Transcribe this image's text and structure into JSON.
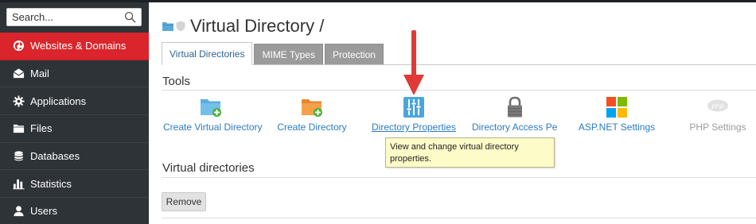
{
  "sidebar": {
    "search": {
      "placeholder": "Search..."
    },
    "items": [
      {
        "label": "Websites & Domains",
        "icon": "globe-icon",
        "active": true
      },
      {
        "label": "Mail",
        "icon": "mail-icon",
        "active": false
      },
      {
        "label": "Applications",
        "icon": "gear-icon",
        "active": false
      },
      {
        "label": "Files",
        "icon": "folder-icon",
        "active": false
      },
      {
        "label": "Databases",
        "icon": "database-icon",
        "active": false
      },
      {
        "label": "Statistics",
        "icon": "bar-chart-icon",
        "active": false
      },
      {
        "label": "Users",
        "icon": "user-icon",
        "active": false
      }
    ]
  },
  "main": {
    "title": "Virtual Directory /",
    "tabs": [
      {
        "label": "Virtual Directories",
        "active": true
      },
      {
        "label": "MIME Types",
        "active": false
      },
      {
        "label": "Protection",
        "active": false
      }
    ],
    "tools_heading": "Tools",
    "tools": [
      {
        "label": "Create Virtual Directory",
        "icon": "folder-add-blue-icon"
      },
      {
        "label": "Create Directory",
        "icon": "folder-add-orange-icon"
      },
      {
        "label": "Directory Properties",
        "icon": "sliders-icon",
        "hovered": true
      },
      {
        "label": "Directory Access Permissions",
        "icon": "lock-icon"
      },
      {
        "label": "ASP.NET Settings",
        "icon": "windows-logo-icon"
      },
      {
        "label": "PHP Settings",
        "icon": "php-icon",
        "disabled": true
      }
    ],
    "tooltip": "View and change virtual directory properties.",
    "vdirs_heading": "Virtual directories",
    "remove_label": "Remove"
  },
  "colors": {
    "sidebar_bg": "#2e3338",
    "active_nav": "#d9252b",
    "link_blue": "#2a7bc1",
    "tab_gray": "#9b9b9b",
    "arrow_red": "#e03a36",
    "tooltip_bg": "#fdfbc8"
  }
}
